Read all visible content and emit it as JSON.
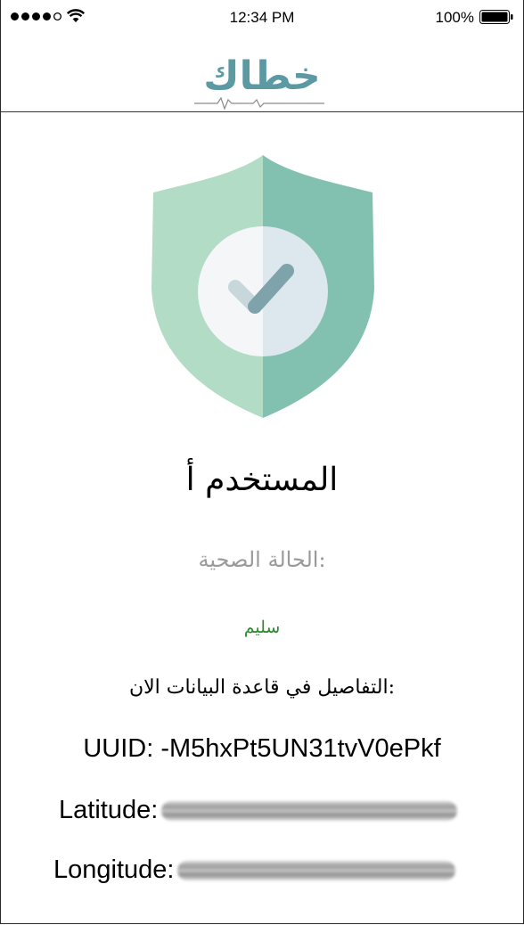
{
  "status_bar": {
    "time": "12:34 PM",
    "battery_percent": "100%",
    "signal_bars_filled": 4,
    "signal_bars_total": 5,
    "icons": [
      "wifi-icon",
      "battery-icon"
    ]
  },
  "header": {
    "logo_text": "خطاك",
    "logo_icon": "heartbeat-line-icon"
  },
  "status_icon": "shield-check-icon",
  "colors": {
    "shield_light": "#b3dcc6",
    "shield_dark": "#82c1b0",
    "check_light": "#c8d7dc",
    "check_dark": "#7ea3aa",
    "health_ok": "#2f8a2f",
    "logo": "#5b9aa3"
  },
  "user": {
    "name": "المستخدم أ",
    "health_label": "الحالة الصحية:",
    "health_status": "سليم"
  },
  "details": {
    "title": "التفاصيل في قاعدة البيانات الان:",
    "uuid": "UUID: -M5hxPt5UN31tvV0ePkf",
    "latitude_label": "Latitude:",
    "longitude_label": "Longitude:"
  }
}
